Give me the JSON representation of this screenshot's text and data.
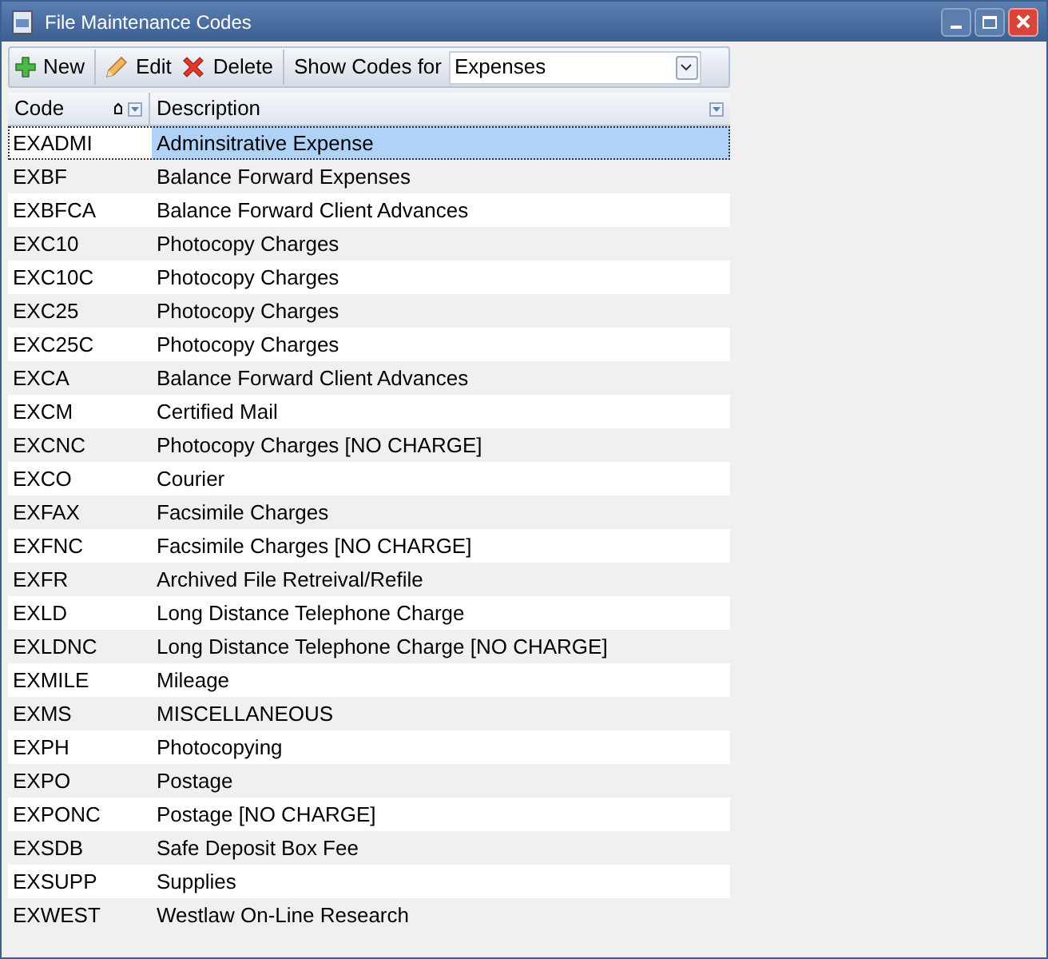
{
  "window": {
    "title": "File Maintenance Codes"
  },
  "toolbar": {
    "buttons": [
      {
        "kind": "new",
        "label": "New"
      },
      {
        "kind": "edit",
        "label": "Edit"
      },
      {
        "kind": "delete",
        "label": "Delete"
      }
    ],
    "filter_label": "Show Codes for",
    "filter_value": "Expenses"
  },
  "table": {
    "columns": [
      {
        "label": "Code",
        "sorted": true
      },
      {
        "label": "Description",
        "sorted": false
      }
    ],
    "rows": [
      {
        "code": "EXADMI",
        "description": "Adminsitrative Expense",
        "selected": true
      },
      {
        "code": "EXBF",
        "description": "Balance Forward Expenses",
        "selected": false
      },
      {
        "code": "EXBFCA",
        "description": "Balance Forward Client Advances",
        "selected": false
      },
      {
        "code": "EXC10",
        "description": "Photocopy Charges",
        "selected": false
      },
      {
        "code": "EXC10C",
        "description": "Photocopy Charges",
        "selected": false
      },
      {
        "code": "EXC25",
        "description": "Photocopy Charges",
        "selected": false
      },
      {
        "code": "EXC25C",
        "description": "Photocopy Charges",
        "selected": false
      },
      {
        "code": "EXCA",
        "description": "Balance Forward Client Advances",
        "selected": false
      },
      {
        "code": "EXCM",
        "description": "Certified Mail",
        "selected": false
      },
      {
        "code": "EXCNC",
        "description": "Photocopy Charges [NO CHARGE]",
        "selected": false
      },
      {
        "code": "EXCO",
        "description": "Courier",
        "selected": false
      },
      {
        "code": "EXFAX",
        "description": "Facsimile Charges",
        "selected": false
      },
      {
        "code": "EXFNC",
        "description": "Facsimile Charges [NO CHARGE]",
        "selected": false
      },
      {
        "code": "EXFR",
        "description": "Archived File Retreival/Refile",
        "selected": false
      },
      {
        "code": "EXLD",
        "description": "Long Distance Telephone Charge",
        "selected": false
      },
      {
        "code": "EXLDNC",
        "description": "Long Distance Telephone Charge [NO CHARGE]",
        "selected": false
      },
      {
        "code": "EXMILE",
        "description": "Mileage",
        "selected": false
      },
      {
        "code": "EXMS",
        "description": "MISCELLANEOUS",
        "selected": false
      },
      {
        "code": "EXPH",
        "description": "Photocopying",
        "selected": false
      },
      {
        "code": "EXPO",
        "description": "Postage",
        "selected": false
      },
      {
        "code": "EXPONC",
        "description": "Postage [NO CHARGE]",
        "selected": false
      },
      {
        "code": "EXSDB",
        "description": "Safe Deposit Box Fee",
        "selected": false
      },
      {
        "code": "EXSUPP",
        "description": "Supplies",
        "selected": false
      },
      {
        "code": "EXWEST",
        "description": "Westlaw On-Line Research",
        "selected": false
      }
    ]
  }
}
